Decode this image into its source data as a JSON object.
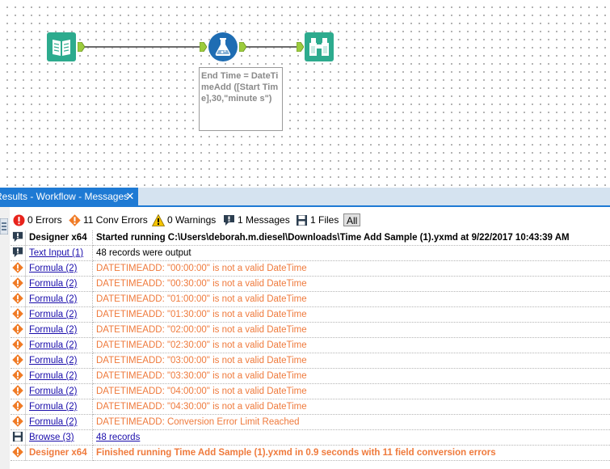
{
  "workflow": {
    "annotation": "End Time = DateTimeAdd ([Start Time],30,\"minute s\")",
    "tools": [
      {
        "id": "text-input",
        "icon": "book-icon"
      },
      {
        "id": "formula",
        "icon": "flask-icon"
      },
      {
        "id": "browse",
        "icon": "binoculars-icon"
      }
    ]
  },
  "panel": {
    "tab_title": "Results - Workflow - Messages",
    "close_glyph": "✕"
  },
  "filters": {
    "errors": "0 Errors",
    "conv_errors": "11 Conv Errors",
    "warnings": "0 Warnings",
    "messages": "1 Messages",
    "files": "1 Files",
    "all": "All"
  },
  "messages": [
    {
      "type": "message",
      "tool": "Designer x64",
      "link": false,
      "text": "Started running C:\\Users\\deborah.m.diesel\\Downloads\\Time Add Sample (1).yxmd at 9/22/2017 10:43:39 AM",
      "style": "bold"
    },
    {
      "type": "message",
      "tool": "Text Input (1)",
      "link": true,
      "text": "48 records were output",
      "style": "normal"
    },
    {
      "type": "conv",
      "tool": "Formula (2)",
      "link": true,
      "text": "DATETIMEADD: \"00:00:00\" is not a valid DateTime",
      "style": "err"
    },
    {
      "type": "conv",
      "tool": "Formula (2)",
      "link": true,
      "text": "DATETIMEADD: \"00:30:00\" is not a valid DateTime",
      "style": "err"
    },
    {
      "type": "conv",
      "tool": "Formula (2)",
      "link": true,
      "text": "DATETIMEADD: \"01:00:00\" is not a valid DateTime",
      "style": "err"
    },
    {
      "type": "conv",
      "tool": "Formula (2)",
      "link": true,
      "text": "DATETIMEADD: \"01:30:00\" is not a valid DateTime",
      "style": "err"
    },
    {
      "type": "conv",
      "tool": "Formula (2)",
      "link": true,
      "text": "DATETIMEADD: \"02:00:00\" is not a valid DateTime",
      "style": "err"
    },
    {
      "type": "conv",
      "tool": "Formula (2)",
      "link": true,
      "text": "DATETIMEADD: \"02:30:00\" is not a valid DateTime",
      "style": "err"
    },
    {
      "type": "conv",
      "tool": "Formula (2)",
      "link": true,
      "text": "DATETIMEADD: \"03:00:00\" is not a valid DateTime",
      "style": "err"
    },
    {
      "type": "conv",
      "tool": "Formula (2)",
      "link": true,
      "text": "DATETIMEADD: \"03:30:00\" is not a valid DateTime",
      "style": "err"
    },
    {
      "type": "conv",
      "tool": "Formula (2)",
      "link": true,
      "text": "DATETIMEADD: \"04:00:00\" is not a valid DateTime",
      "style": "err"
    },
    {
      "type": "conv",
      "tool": "Formula (2)",
      "link": true,
      "text": "DATETIMEADD: \"04:30:00\" is not a valid DateTime",
      "style": "err"
    },
    {
      "type": "conv",
      "tool": "Formula (2)",
      "link": true,
      "text": "DATETIMEADD: Conversion Error Limit Reached",
      "style": "err"
    },
    {
      "type": "file",
      "tool": "Browse (3)",
      "link": true,
      "text": "48 records",
      "style": "link"
    },
    {
      "type": "conv",
      "tool": "Designer x64",
      "link": false,
      "text": "Finished running Time Add Sample (1).yxmd in 0.9 seconds with 11 field conversion errors",
      "style": "finish"
    }
  ],
  "colors": {
    "accent": "#1e7ad4",
    "error": "#e8231c",
    "conv_error": "#f07b26",
    "warning": "#f5c400",
    "text_input_tool": "#2dab8e",
    "formula_tool": "#1f6db3"
  }
}
